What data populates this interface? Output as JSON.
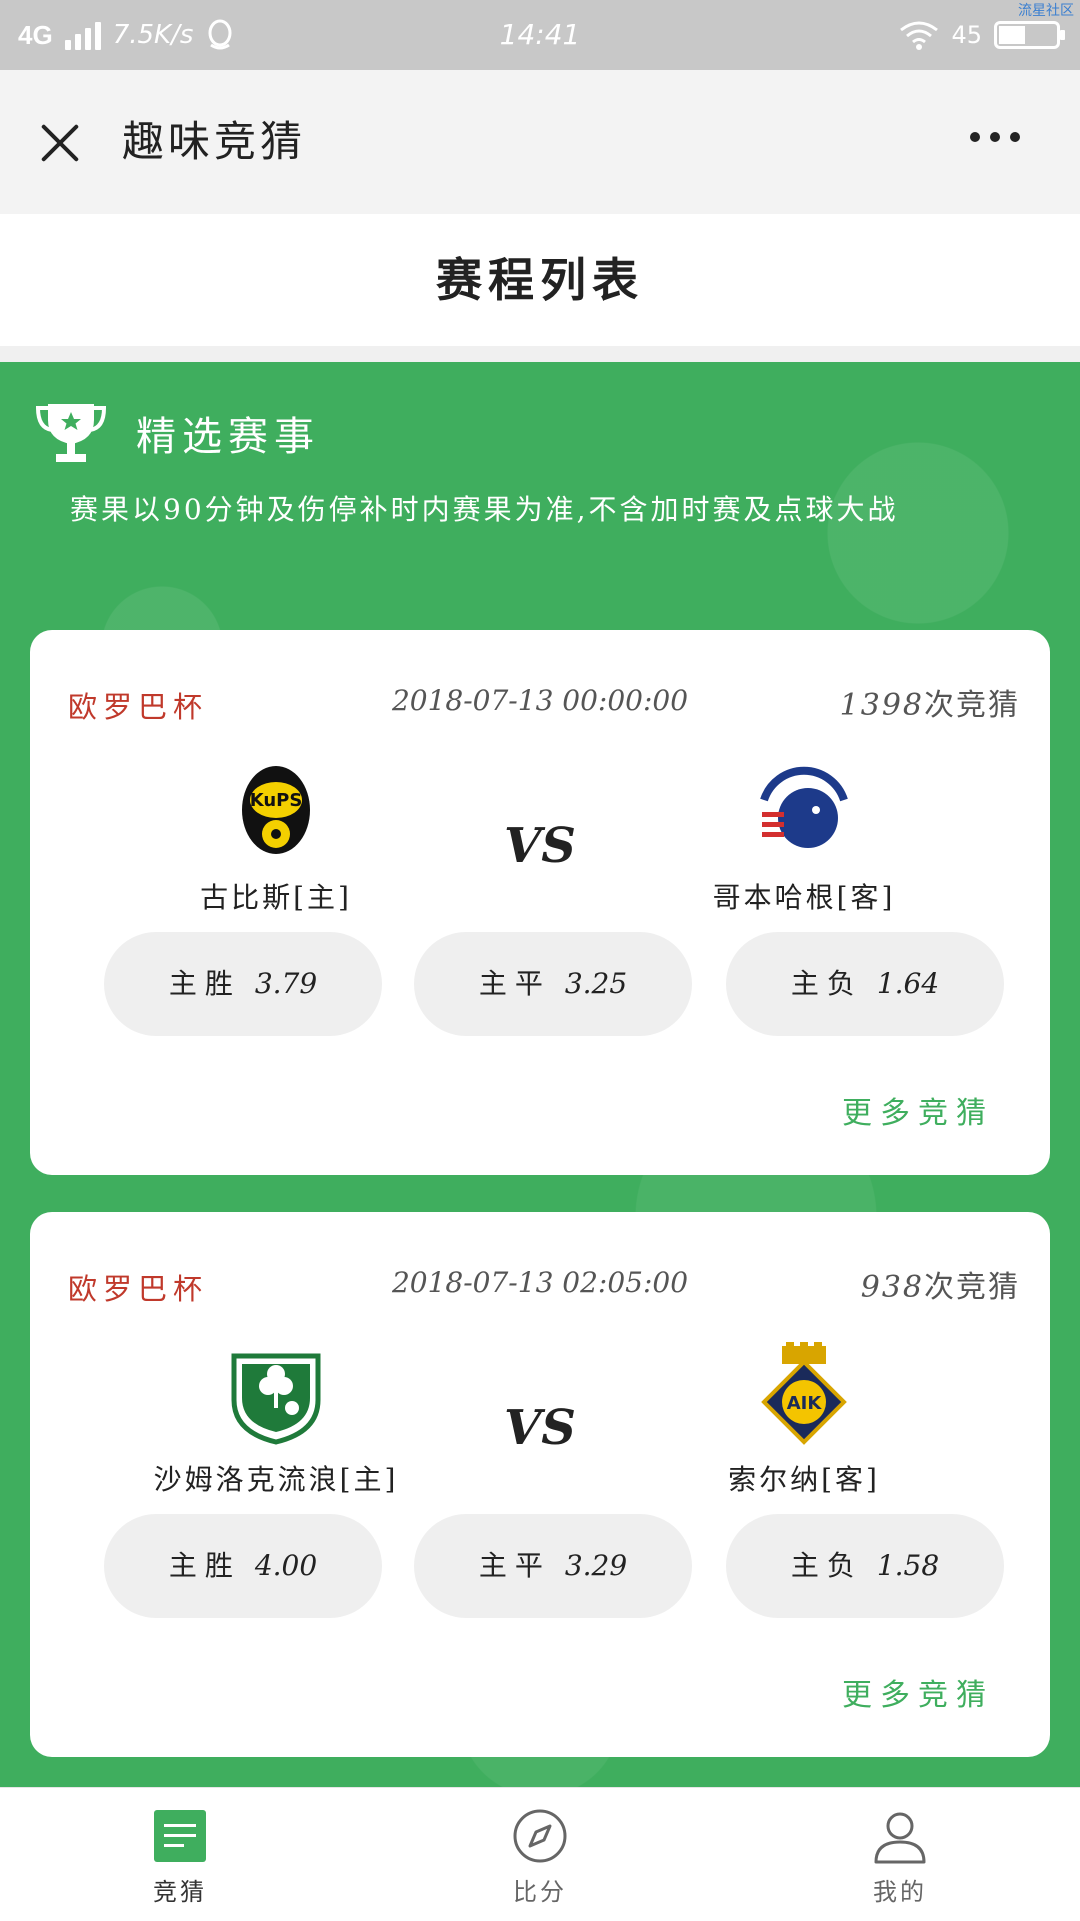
{
  "status_bar": {
    "network": "4G",
    "speed": "7.5K/s",
    "time": "14:41",
    "battery": "45",
    "corner_tag": "流星社区"
  },
  "nav": {
    "title": "趣味竞猜"
  },
  "page_title": "赛程列表",
  "featured": {
    "title": "精选赛事",
    "description": "赛果以90分钟及伤停补时内赛果为准,不含加时赛及点球大战"
  },
  "matches": [
    {
      "league": "欧罗巴杯",
      "datetime": "2018-07-13 00:00:00",
      "count": "1398",
      "count_suffix": "次竞猜",
      "home": {
        "name": "古比斯[主]",
        "logo": "kups-logo"
      },
      "away": {
        "name": "哥本哈根[客]",
        "logo": "fc-kobenhavn-logo"
      },
      "vs": "VS",
      "odds": [
        {
          "label": "主胜",
          "value": "3.79"
        },
        {
          "label": "主平",
          "value": "3.25"
        },
        {
          "label": "主负",
          "value": "1.64"
        }
      ],
      "more": "更多竞猜"
    },
    {
      "league": "欧罗巴杯",
      "datetime": "2018-07-13 02:05:00",
      "count": "938",
      "count_suffix": "次竞猜",
      "home": {
        "name": "沙姆洛克流浪[主]",
        "logo": "shamrock-rovers-logo"
      },
      "away": {
        "name": "索尔纳[客]",
        "logo": "aik-logo"
      },
      "vs": "VS",
      "odds": [
        {
          "label": "主胜",
          "value": "4.00"
        },
        {
          "label": "主平",
          "value": "3.29"
        },
        {
          "label": "主负",
          "value": "1.58"
        }
      ],
      "more": "更多竞猜"
    }
  ],
  "tabs": [
    {
      "label": "竞猜",
      "icon": "document-list-icon",
      "active": true
    },
    {
      "label": "比分",
      "icon": "compass-icon",
      "active": false
    },
    {
      "label": "我的",
      "icon": "user-icon",
      "active": false
    }
  ],
  "colors": {
    "green": "#3fae5e",
    "league_red": "#c0392b",
    "status_bar": "#c8c8c8"
  }
}
